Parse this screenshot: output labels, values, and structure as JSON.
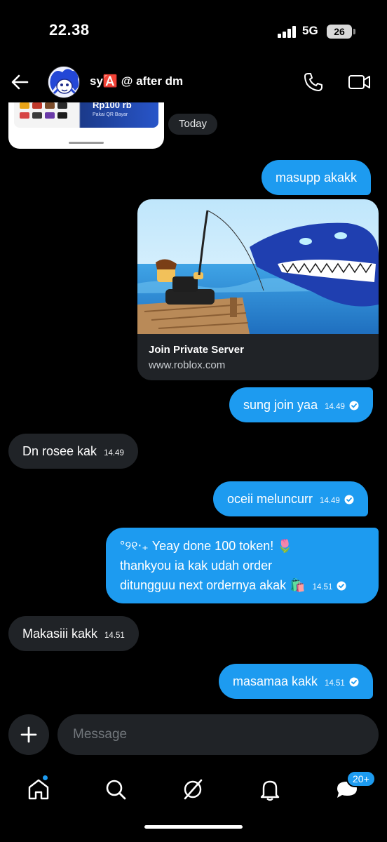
{
  "status": {
    "time": "22.38",
    "network": "5G",
    "battery": "26"
  },
  "header": {
    "name": "sy🅰️ @ after dm"
  },
  "previous_card": {
    "price": "Rp100 rb",
    "subtitle": "Pakai QR Bayar"
  },
  "date_divider": "Today",
  "messages": [
    {
      "dir": "out",
      "text": "masupp akakk",
      "time": ""
    },
    {
      "dir": "out",
      "type": "link",
      "title": "Join Private Server",
      "domain": "www.roblox.com"
    },
    {
      "dir": "out",
      "text": "sung join yaa",
      "time": "14.49"
    },
    {
      "dir": "in",
      "text": "Dn rosee kak",
      "time": "14.49"
    },
    {
      "dir": "out",
      "text": "oceii meluncurr",
      "time": "14.49"
    },
    {
      "dir": "out",
      "lines": [
        "°୨୧‧₊ Yeay done 100 token! 🌷",
        "thankyou ia kak udah order",
        "ditungguu next ordernya akak 🛍️"
      ],
      "time": "14.51"
    },
    {
      "dir": "in",
      "text": "Makasiii kakk",
      "time": "14.51"
    },
    {
      "dir": "out",
      "text": "masamaa kakk",
      "time": "14.51"
    }
  ],
  "composer": {
    "placeholder": "Message"
  },
  "tabbar": {
    "icons": [
      "home-icon",
      "search-icon",
      "grok-icon",
      "bell-icon",
      "messages-icon"
    ],
    "messages_badge": "20+"
  },
  "colors": {
    "accent": "#1d9bf0",
    "incoming_bubble": "#202327",
    "background": "#000000"
  }
}
